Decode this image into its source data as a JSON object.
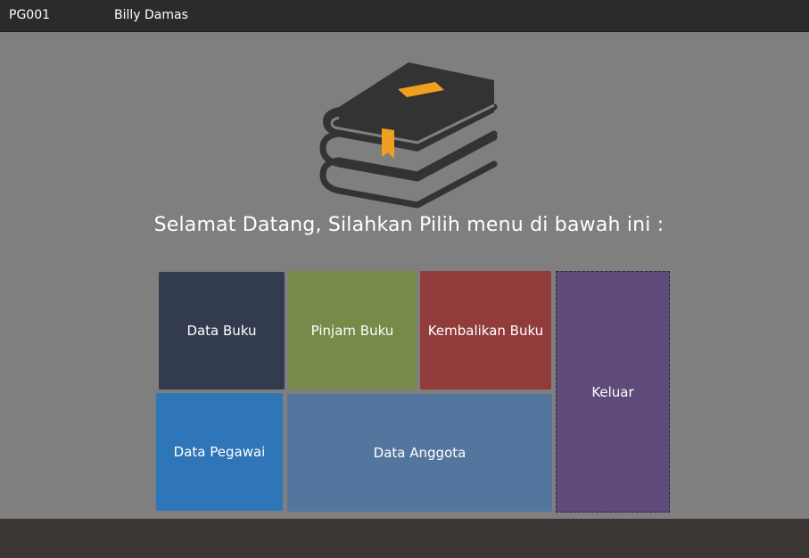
{
  "header": {
    "user_id": "PG001",
    "user_name": "Billy Damas"
  },
  "main": {
    "welcome_text": "Selamat Datang, Silahkan Pilih menu di bawah ini :",
    "logo_icon": "books-stack-icon",
    "menu": {
      "data_buku": "Data Buku",
      "pinjam_buku": "Pinjam Buku",
      "kembalikan_buku": "Kembalikan Buku",
      "keluar": "Keluar",
      "data_pegawai": "Data Pegawai",
      "data_anggota": "Data Anggota"
    }
  },
  "colors": {
    "background": "#7f7f7f",
    "header": "#2b2b2b",
    "footer": "#3a3735",
    "data_buku": "#333c4f",
    "pinjam_buku": "#768a49",
    "kembalikan_buku": "#913c3a",
    "keluar": "#5f4b7a",
    "data_pegawai": "#2e76b7",
    "data_anggota": "#53759e",
    "logo_accent": "#f0a020"
  }
}
